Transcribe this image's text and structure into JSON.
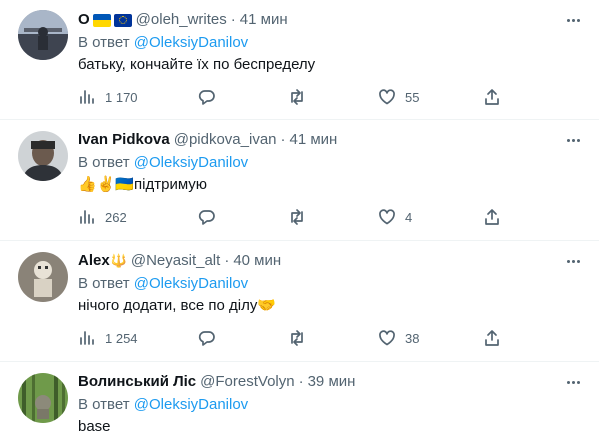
{
  "tweets": [
    {
      "name": "О",
      "handle": "@oleh_writes",
      "time": "41 мин",
      "reply_prefix": "В ответ",
      "reply_to": "@OleksiyDanilov",
      "text": "батьку, кончайте їх по беспределу",
      "views": "1 170",
      "replies": "",
      "retweets": "",
      "likes": "55"
    },
    {
      "name": "Ivan Pidkova",
      "handle": "@pidkova_ivan",
      "time": "41 мин",
      "reply_prefix": "В ответ",
      "reply_to": "@OleksiyDanilov",
      "text": "👍✌️🇺🇦підтримую",
      "views": "262",
      "replies": "",
      "retweets": "",
      "likes": "4"
    },
    {
      "name": "Alex",
      "name_suffix": "🔱",
      "handle": "@Neyasit_alt",
      "time": "40 мин",
      "reply_prefix": "В ответ",
      "reply_to": "@OleksiyDanilov",
      "text": "нічого додати, все по ділу🤝",
      "views": "1 254",
      "replies": "",
      "retweets": "",
      "likes": "38"
    },
    {
      "name": "Волинський Ліс",
      "handle": "@ForestVolyn",
      "time": "39 мин",
      "reply_prefix": "В ответ",
      "reply_to": "@OleksiyDanilov",
      "text": "base"
    }
  ],
  "colors": {
    "text": "#0f1419",
    "secondary": "#536471",
    "link": "#1d9bf0",
    "divider": "#eff3f4"
  },
  "icons": [
    "views-icon",
    "reply-icon",
    "retweet-icon",
    "like-icon",
    "share-icon",
    "more-icon"
  ]
}
